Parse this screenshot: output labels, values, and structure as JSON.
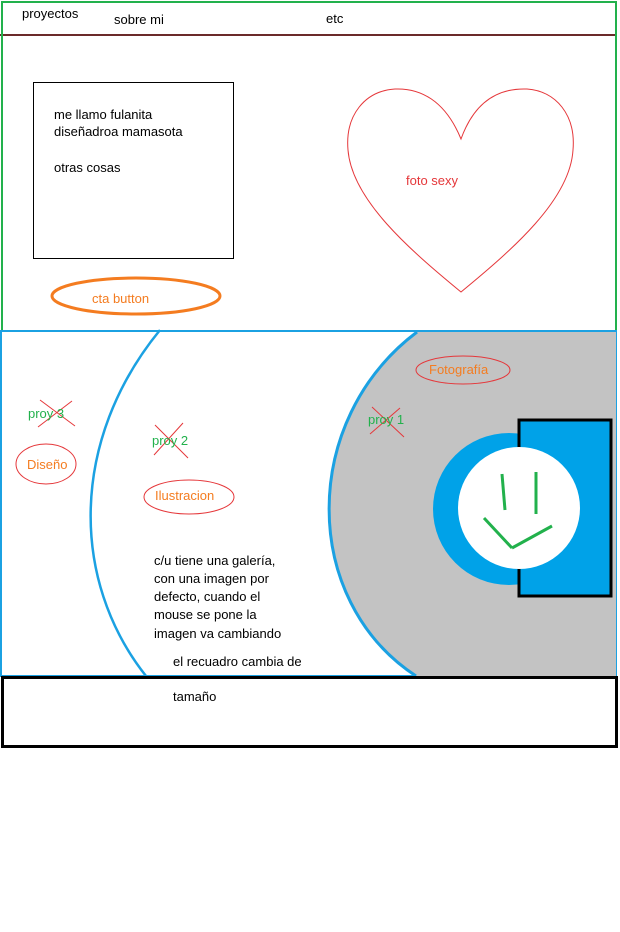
{
  "nav": {
    "items": [
      "proyectos",
      "sobre mi",
      "etc"
    ]
  },
  "hero": {
    "intro_lines": [
      "me llamo fulanita",
      "diseñadroa mamasota",
      "otras cosas"
    ],
    "photo_label": "foto sexy",
    "cta_label": "cta button"
  },
  "projects": {
    "labels": {
      "fotografia": "Fotografía",
      "diseno": "Diseño",
      "ilustracion": "Ilustracion"
    },
    "items": [
      "proy 1",
      "proy 2",
      "proy 3"
    ],
    "note_lines": [
      "c/u tiene una galería,",
      "con una imagen por",
      "defecto, cuando el",
      "mouse se pone la",
      "imagen va cambiando"
    ],
    "resize_note": [
      "el recuadro cambia de",
      "tamaño"
    ]
  },
  "colors": {
    "hero_border": "#22b14c",
    "projects_border": "#1ba1e2",
    "grey_area": "#c3c3c3",
    "accent_orange": "#f47c20",
    "heart_red": "#e5373a",
    "label_green": "#22b14c"
  },
  "icons": [
    "heart-icon",
    "clock-icon",
    "cross-out-icon"
  ]
}
